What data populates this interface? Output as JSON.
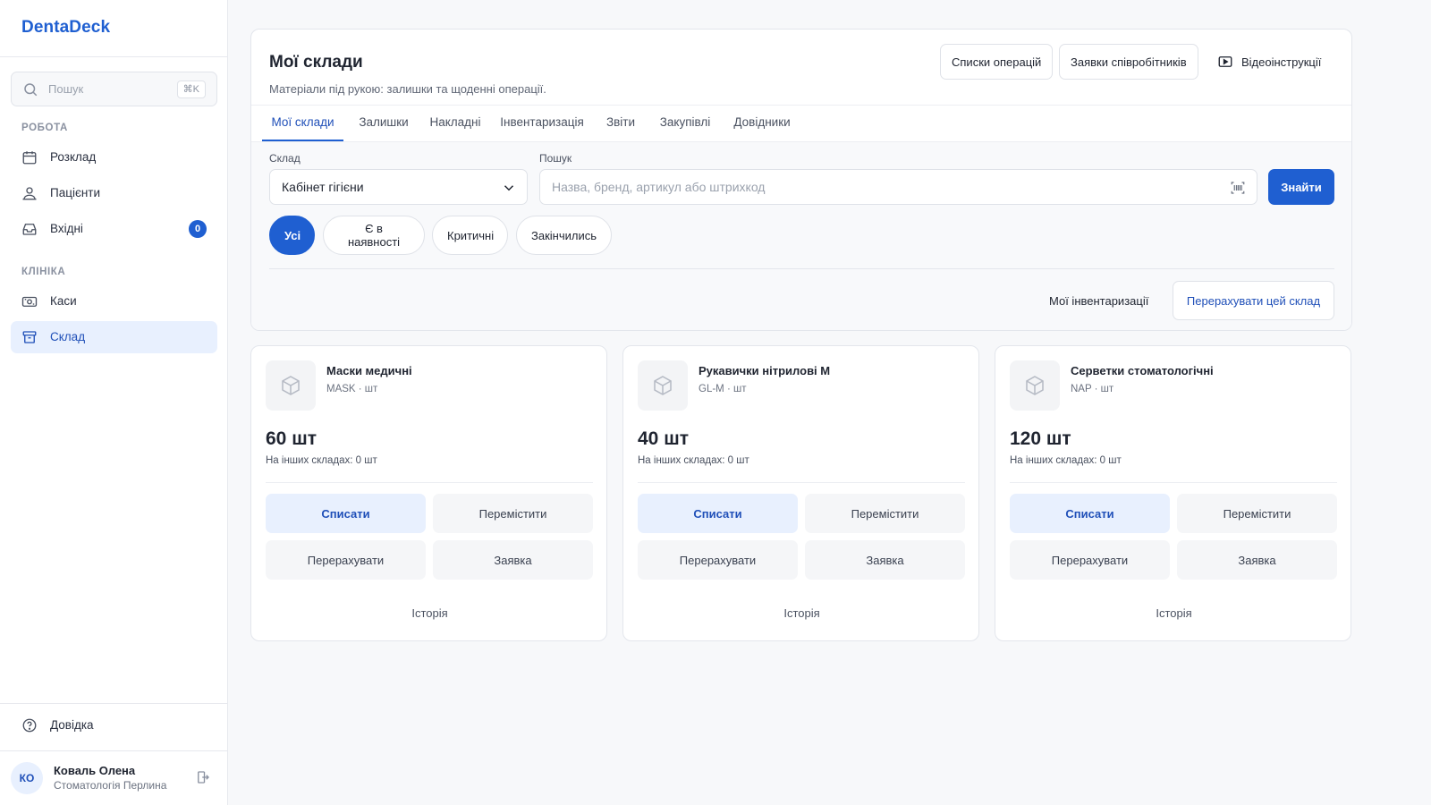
{
  "sidebar": {
    "brand": "DentaDeck",
    "search": {
      "placeholder": "Пошук",
      "shortcut": "⌘K"
    },
    "sections": [
      {
        "label": "РОБОТА"
      },
      {
        "label": "КЛІНІКА"
      }
    ],
    "items": [
      {
        "label": "Розклад",
        "icon": "calendar-icon"
      },
      {
        "label": "Пацієнти",
        "icon": "users-icon"
      },
      {
        "label": "Вхідні",
        "icon": "inbox-icon",
        "badge": "0"
      },
      {
        "label": "Каси",
        "icon": "cash-icon"
      },
      {
        "label": "Склад",
        "icon": "archive-icon",
        "active": true
      }
    ],
    "help": {
      "label": "Довідка",
      "icon": "help-circle-icon"
    },
    "user": {
      "initials": "КО",
      "name": "Коваль Олена",
      "org": "Стоматологія Перлина"
    }
  },
  "header": {
    "title": "Мої склади",
    "subtitle": "Матеріали під рукою: залишки та щоденні операції.",
    "buttons": {
      "operations": "Списки операцій",
      "requests": "Заявки співробітників",
      "videos": "Відеоінструкції"
    }
  },
  "tabs": [
    {
      "label": "Мої склади",
      "active": true
    },
    {
      "label": "Залишки"
    },
    {
      "label": "Накладні"
    },
    {
      "label": "Інвентаризація"
    },
    {
      "label": "Звіти"
    },
    {
      "label": "Закупівлі"
    },
    {
      "label": "Довідники"
    }
  ],
  "filters": {
    "warehouse_label": "Склад",
    "warehouse_value": "Кабінет гігієни",
    "search_label": "Пошук",
    "search_placeholder": "Назва, бренд, артикул або штрихкод",
    "find_button": "Знайти",
    "chips": [
      {
        "label": "Усі",
        "active": true
      },
      {
        "label": "Є в наявності"
      },
      {
        "label": "Критичні"
      },
      {
        "label": "Закінчились"
      }
    ],
    "my_inventories": "Мої інвентаризації",
    "recount_warehouse": "Перерахувати цей склад"
  },
  "cards": [
    {
      "name": "Маски медичні",
      "meta": "MASK · шт",
      "qty": "60 шт",
      "other": "На інших складах: 0 шт",
      "actions": {
        "write_off": "Списати",
        "move": "Перемістити",
        "recount": "Перерахувати",
        "request": "Заявка"
      },
      "history": "Історія"
    },
    {
      "name": "Рукавички нітрилові M",
      "meta": "GL-M · шт",
      "qty": "40 шт",
      "other": "На інших складах: 0 шт",
      "actions": {
        "write_off": "Списати",
        "move": "Перемістити",
        "recount": "Перерахувати",
        "request": "Заявка"
      },
      "history": "Історія"
    },
    {
      "name": "Серветки стоматологічні",
      "meta": "NAP · шт",
      "qty": "120 шт",
      "other": "На інших складах: 0 шт",
      "actions": {
        "write_off": "Списати",
        "move": "Перемістити",
        "recount": "Перерахувати",
        "request": "Заявка"
      },
      "history": "Історія"
    }
  ],
  "colors": {
    "accent": "#1f5fd1",
    "accent_soft": "#e8f0fe",
    "background": "#f7f8fa"
  }
}
